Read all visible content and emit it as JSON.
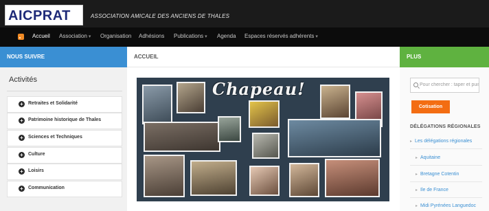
{
  "header": {
    "logo": "AICPRAT",
    "title": "ASSOCIATION AMICALE DES ANCIENS DE THALES"
  },
  "nav": {
    "items": [
      {
        "label": "Accueil",
        "has_dropdown": false,
        "active": true
      },
      {
        "label": "Association",
        "has_dropdown": true,
        "active": false
      },
      {
        "label": "Organisation",
        "has_dropdown": false,
        "active": false
      },
      {
        "label": "Adhésions",
        "has_dropdown": false,
        "active": false
      },
      {
        "label": "Publications",
        "has_dropdown": true,
        "active": false
      },
      {
        "label": "Agenda",
        "has_dropdown": false,
        "active": false
      },
      {
        "label": "Espaces réservés adhérents",
        "has_dropdown": true,
        "active": false
      }
    ],
    "rss_icon": "rss-icon",
    "caret_glyph": "▾"
  },
  "left": {
    "header": "NOUS SUIVRE",
    "activities_title": "Activités",
    "activities": [
      "Retraites et Solidarité",
      "Patrimoine historique de Thales",
      "Sciences et Techniques",
      "Culture",
      "Loisirs",
      "Communication"
    ],
    "item_icon": "plus-circle-icon",
    "item_glyph": "+"
  },
  "main": {
    "header": "ACCUEIL",
    "banner_text": "Chapeau!"
  },
  "right": {
    "header": "PLUS",
    "search_placeholder": "Pour chercher : taper et puis",
    "cotisation_label": "Cotisation",
    "delegations_title": "DÉLÉGATIONS RÉGIONALES",
    "delegations": [
      "Les délégations régionales",
      "Aquitaine",
      "Bretagne Cotentin",
      "Ile de France",
      "Midi Pyrénées Languedoc"
    ]
  },
  "colors": {
    "header_bg": "#1b1b1b",
    "nav_bg": "#0c0c0c",
    "blue_accent": "#3a8fd3",
    "green_accent": "#5fb240",
    "orange_button": "#f36d12",
    "logo_blue": "#1e2a78"
  }
}
